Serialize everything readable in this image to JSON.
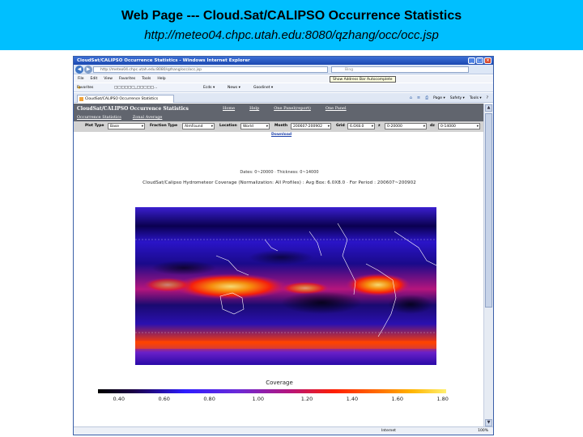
{
  "slide": {
    "title": "Web Page --- Cloud.Sat/CALIPSO Occurrence Statistics",
    "url": "http://meteo04.chpc.utah.edu:8080/qzhang/occ/occ.jsp"
  },
  "browser": {
    "window_title": "CloudSat/CALIPSO Occurrence Statistics - Windows Internet Explorer",
    "address": "http://meteo04.chpc.utah.edu:8080/qzhang/occ/occ.jsp",
    "search_placeholder": "Bing",
    "tooltip": "Show Address Bar Autocomplete",
    "menu": [
      "File",
      "Edit",
      "View",
      "Favorites",
      "Tools",
      "Help"
    ],
    "favorites_label": "Favorites",
    "fav_links": [
      "□□□□□□_□□□□□...",
      "Ecds ▾",
      "News ▾",
      "Goodinet ▾"
    ],
    "tab_label": "CloudSat/CALIPSO Occurrence Statistics",
    "commands": [
      "Page ▾",
      "Safety ▾",
      "Tools ▾",
      "?"
    ],
    "status_zone": "Internet",
    "status_zoom": "100%"
  },
  "site": {
    "title": "CloudSat/CALIPSO Occurrence Statistics",
    "links": [
      "Home",
      "Help",
      "One Panel(report)",
      "One Panel"
    ],
    "tabs": [
      "Occurrence Statistics",
      "Zonal Average"
    ],
    "controls": {
      "plot_type_label": "Plot Type",
      "plot_type_value": "Base",
      "fraction_type_label": "Fraction Type",
      "fraction_type_value": "AlmFound",
      "location_label": "Location",
      "location_value": "World",
      "month_label": "Month",
      "month_value": "200607-200902",
      "grid_label": "Grid",
      "grid_value": "6.0X8.0",
      "z_label": "z",
      "z_value": "0-20000",
      "dz_label": "dz",
      "dz_value": "0-14000"
    },
    "download": "Download",
    "dates_line": "Dates: 0~20000 · Thickness: 0~14000",
    "plot_title": "CloudSat/Calipso Hydrometeor Coverage (Normalization: All Profiles) : Avg Box: 6.0X8.0 · For Period : 200607~200902",
    "colorbar_title": "Coverage",
    "colorbar_ticks": [
      "0.40",
      "0.60",
      "0.80",
      "1.00",
      "1.20",
      "1.40",
      "1.60",
      "1.80"
    ],
    "colorbar_ticks_pct": [
      0.06,
      0.19,
      0.32,
      0.46,
      0.6,
      0.73,
      0.86,
      0.99
    ]
  }
}
